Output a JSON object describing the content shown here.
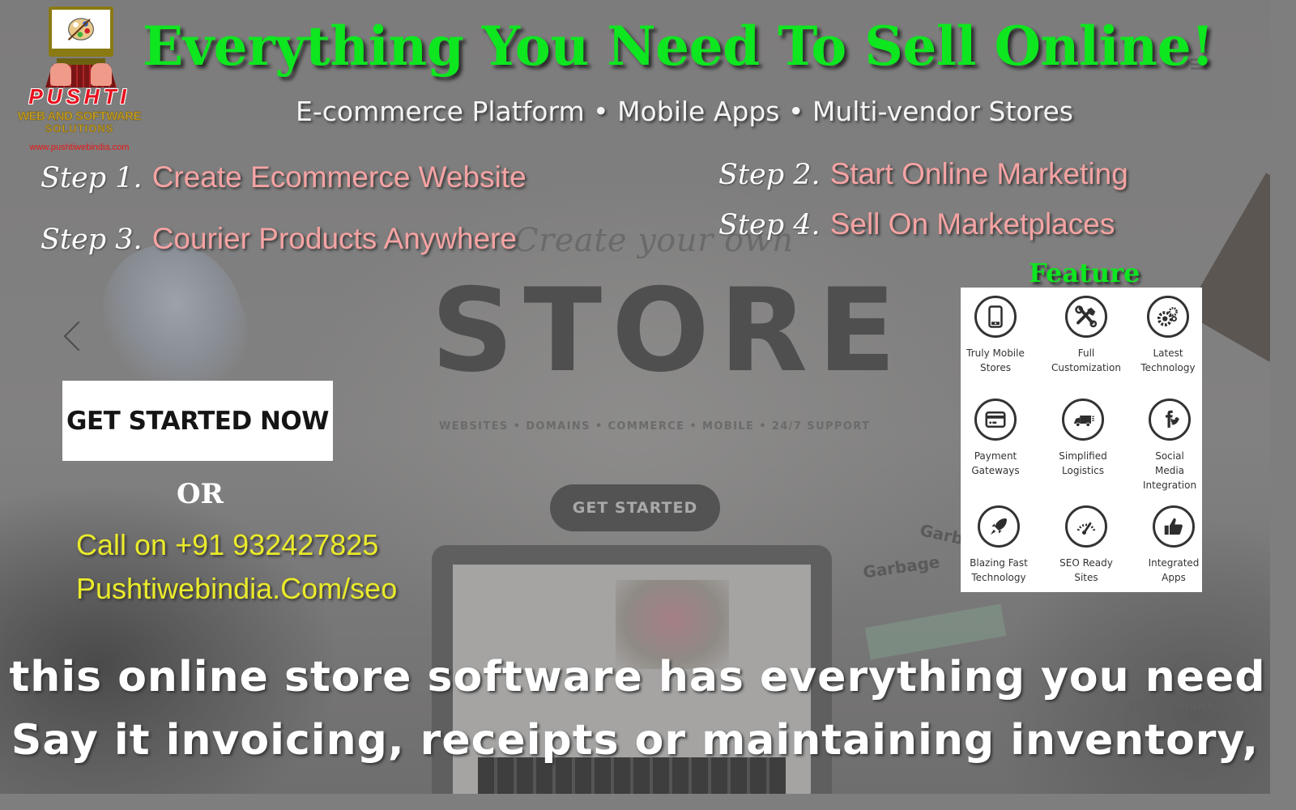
{
  "logo": {
    "brand": "PUSHTI",
    "line1": "WEB AND SOFTWARE",
    "line2": "SOLUTIONS",
    "url": "www.pushtiwebindia.com",
    "icon": "palette-computer-icon"
  },
  "headline": "Everything You Need To Sell Online!",
  "subline": "E-commerce Platform • Mobile Apps • Multi-vendor Stores",
  "steps": [
    {
      "label": "Step 1.",
      "text": "Create Ecommerce Website"
    },
    {
      "label": "Step 2.",
      "text": "Start Online Marketing"
    },
    {
      "label": "Step 3.",
      "text": "Courier Products Anywhere"
    },
    {
      "label": "Step 4.",
      "text": "Sell On Marketplaces"
    }
  ],
  "background": {
    "tagline": "Create your own",
    "store": "STORE",
    "services": "WEBSITES • DOMAINS • COMMERCE • MOBILE • 24/7 SUPPORT",
    "button": "GET STARTED",
    "garbage": "Garbage",
    "justin": "JUSTIN GIGNAC"
  },
  "cta": {
    "button": "GET STARTED NOW",
    "or": "OR",
    "call": "Call on +91 932427825",
    "site": "Pushtiwebindia.Com/seo"
  },
  "features": {
    "title": "Feature",
    "items": [
      {
        "label": "Truly Mobile Stores",
        "line1": "Truly Mobile",
        "line2": "Stores",
        "line3": "",
        "icon": "mobile-phone-icon"
      },
      {
        "label": "Full Customization",
        "line1": "Full",
        "line2": "Customization",
        "line3": "",
        "icon": "tools-icon"
      },
      {
        "label": "Latest Technology",
        "line1": "Latest",
        "line2": "Technology",
        "line3": "",
        "icon": "gears-icon"
      },
      {
        "label": "Payment Gateways",
        "line1": "Payment",
        "line2": "Gateways",
        "line3": "",
        "icon": "credit-card-icon"
      },
      {
        "label": "Simplified Logistics",
        "line1": "Simplified",
        "line2": "Logistics",
        "line3": "",
        "icon": "delivery-truck-icon"
      },
      {
        "label": "Social Media Integration",
        "line1": "Social",
        "line2": "Media",
        "line3": "Integration",
        "icon": "facebook-twitter-icon"
      },
      {
        "label": "Blazing Fast Technology",
        "line1": "Blazing Fast",
        "line2": "Technology",
        "line3": "",
        "icon": "rocket-icon"
      },
      {
        "label": "SEO Ready Sites",
        "line1": "SEO Ready",
        "line2": "Sites",
        "line3": "",
        "icon": "speedometer-icon"
      },
      {
        "label": "Integrated Apps",
        "line1": "Integrated",
        "line2": "Apps",
        "line3": "",
        "icon": "thumbs-up-icon"
      }
    ]
  },
  "bottom": {
    "line1": "this online store software has everything you need",
    "line2": "Say it invoicing, receipts or maintaining inventory,"
  },
  "colors": {
    "headline_green": "#0ee620",
    "step_pink": "#f5a3a3",
    "contact_yellow": "#eaea2c",
    "logo_red": "#e8101e",
    "logo_gold": "#c9a227"
  }
}
